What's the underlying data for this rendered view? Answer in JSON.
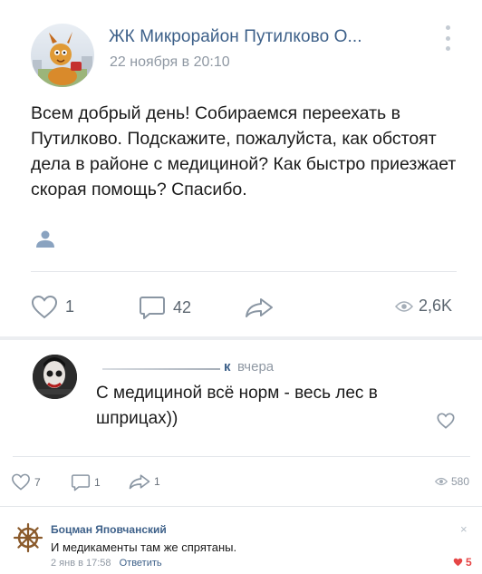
{
  "post": {
    "author": "ЖК Микрорайон Путилково О...",
    "date": "22 ноября в 20:10",
    "text": "Всем добрый день! Собираемся переехать в Путилково. Подскажите, пожалуйста, как обстоят дела в районе с медициной? Как быстро приезжает скорая помощь? Спасибо.",
    "likes": "1",
    "comments": "42",
    "views": "2,6K",
    "icons": [
      "more-vertical-icon",
      "people-icon",
      "heart-outline-icon",
      "comment-icon",
      "share-arrow-icon",
      "eye-icon"
    ]
  },
  "comment": {
    "author_tail": "к",
    "time": "вчера",
    "text": "С медициной всё норм - весь лес в шприцах))",
    "icons": [
      "heart-outline-icon"
    ]
  },
  "comment_stats": {
    "likes": "7",
    "comments": "1",
    "shares": "1",
    "views": "580"
  },
  "reply": {
    "author": "Боцман Яповчанский",
    "text": "И медикаменты там же спрятаны.",
    "date": "2 янв в 17:58",
    "reply_label": "Ответить",
    "close_glyph": "×",
    "likes": "5",
    "icons": [
      "ship-wheel-icon",
      "close-icon",
      "heart-filled-icon"
    ]
  },
  "colors": {
    "link": "#3d6089",
    "muted": "#8f98a3",
    "like_active": "#e64646",
    "divider": "#e3e6ea"
  }
}
